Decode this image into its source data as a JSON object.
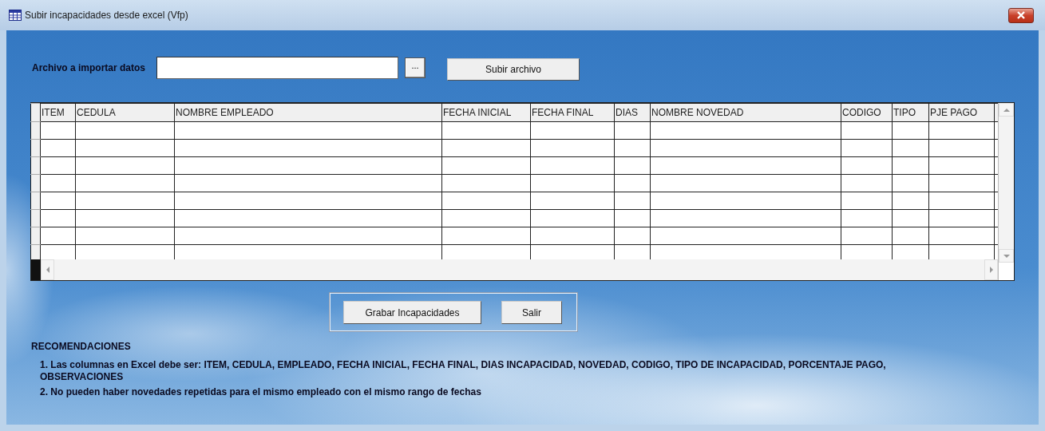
{
  "window": {
    "title": "Subir incapacidades desde excel (Vfp)"
  },
  "file_import": {
    "label": "Archivo a importar datos",
    "browse_button": "...",
    "upload_button": "Subir archivo"
  },
  "table": {
    "columns": [
      "ITEM",
      "CEDULA",
      "NOMBRE EMPLEADO",
      "FECHA INICIAL",
      "FECHA FINAL",
      "DIAS",
      "NOMBRE NOVEDAD",
      "CODIGO",
      "TIPO",
      "PJE PAGO"
    ]
  },
  "buttons": [
    "Grabar Incapacidades",
    "Salir"
  ],
  "recommendations": {
    "title": "RECOMENDACIONES",
    "items": [
      "1. Las columnas en Excel debe ser: ITEM, CEDULA, EMPLEADO, FECHA INICIAL, FECHA FINAL, DIAS INCAPACIDAD, NOVEDAD, CODIGO, TIPO DE INCAPACIDAD, PORCENTAJE PAGO, OBSERVACIONES",
      "2. No pueden haber novedades repetidas para el mismo empleado con el mismo rango de fechas"
    ]
  }
}
